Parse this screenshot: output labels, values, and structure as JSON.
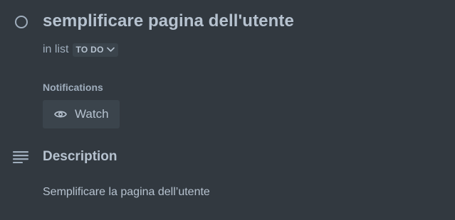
{
  "card": {
    "title": "semplificare pagina dell'utente",
    "list_prefix": "in list",
    "list_name": "TO DO"
  },
  "notifications": {
    "label": "Notifications",
    "watch_label": "Watch"
  },
  "description": {
    "heading": "Description",
    "text": "Semplificare la pagina dell’utente"
  },
  "icons": {
    "complete": "circle-outline-icon",
    "list_dropdown": "chevron-down-icon",
    "watch": "eye-icon",
    "description": "text-lines-icon"
  },
  "colors": {
    "background": "#323940",
    "button_background": "#3b444c",
    "text_primary": "#b6c2cf",
    "text_secondary": "#9fadbc"
  }
}
